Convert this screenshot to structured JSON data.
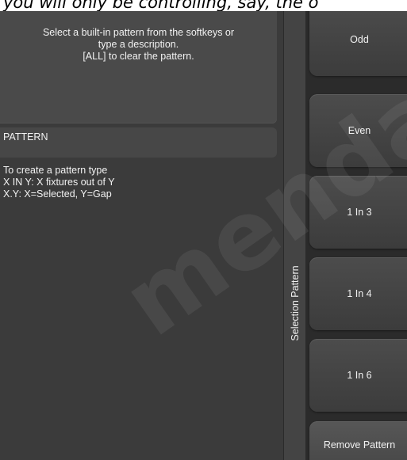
{
  "caption": {
    "text": "you will only be controlling, say, the o"
  },
  "command_line": {
    "prompt": "Select a built-in pattern from the softkeys or\ntype a description.\n[ALL] to clear the pattern."
  },
  "section": {
    "title": "PATTERN",
    "help": "To create a pattern type\nX IN Y: X fixtures out of Y\nX.Y: X=Selected, Y=Gap"
  },
  "softkey_panel": {
    "title": "Selection Pattern",
    "keys": [
      {
        "label": "Odd"
      },
      {
        "label": "Even"
      },
      {
        "label": "1 In 3"
      },
      {
        "label": "1 In 4"
      },
      {
        "label": "1 In 6"
      },
      {
        "label": "Remove Pattern"
      }
    ]
  },
  "watermark": {
    "text": "menda"
  }
}
